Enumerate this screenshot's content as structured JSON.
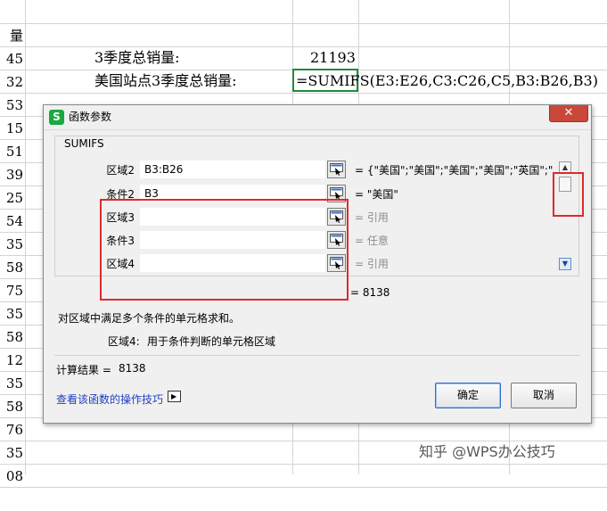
{
  "sheet": {
    "col_header_fragment": "量",
    "col_a_values": [
      "45",
      "32",
      "53",
      "15",
      "51",
      "39",
      "25",
      "54",
      "35",
      "58",
      "75",
      "35",
      "58",
      "12",
      "35",
      "58",
      "76",
      "35",
      "08",
      ""
    ],
    "label_q3_total": "3季度总销量:",
    "value_q3_total": "21193",
    "label_us_q3_total": "美国站点3季度总销量:",
    "formula_text": "=SUMIFS(E3:E26,C3:C26,C5,B3:B26,B3)"
  },
  "dialog": {
    "app_icon_glyph": "S",
    "title": "函数参数",
    "close_glyph": "✕",
    "function_name": "SUMIFS",
    "args": [
      {
        "label": "区域2",
        "value": "B3:B26",
        "result": "= {\"美国\";\"美国\";\"美国\";\"美国\";\"英国\";\"...",
        "hint": false
      },
      {
        "label": "条件2",
        "value": "B3",
        "result": "= \"美国\"",
        "hint": false
      },
      {
        "label": "区域3",
        "value": "",
        "result": "= 引用",
        "hint": true
      },
      {
        "label": "条件3",
        "value": "",
        "result": "= 任意",
        "hint": true
      },
      {
        "label": "区域4",
        "value": "",
        "result": "= 引用",
        "hint": true
      }
    ],
    "scroll_up_glyph": "▲",
    "scroll_down_glyph": "▼",
    "total_result": "= 8138",
    "description": "对区域中满足多个条件的单元格求和。",
    "arg_desc_name": "区域4:",
    "arg_desc_text": "用于条件判断的单元格区域",
    "calc_label": "计算结果 =",
    "calc_value": "8138",
    "help_link": "查看该函数的操作技巧",
    "ok_label": "确定",
    "cancel_label": "取消"
  },
  "watermark": "知乎 @WPS办公技巧",
  "colors": {
    "highlight_red": "#e0292c",
    "formula_border": "#1f8a3c",
    "app_icon": "#1aa83f",
    "link": "#1f3fbf"
  }
}
